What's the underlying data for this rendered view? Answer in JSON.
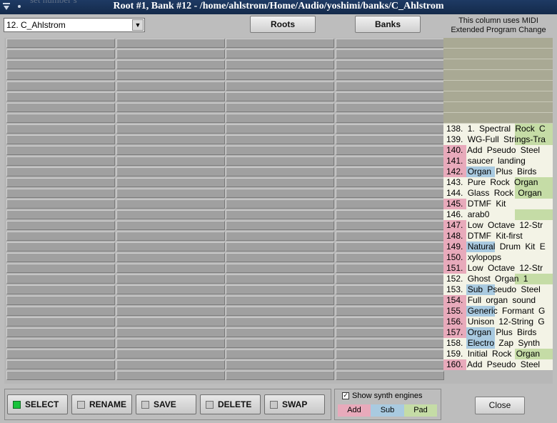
{
  "window": {
    "title": "Root #1, Bank #12 - /home/ahlstrom/Home/Audio/yoshimi/banks/C_Ahlstrom",
    "ghost_text": "set number s"
  },
  "toolbar": {
    "bank_selected": "12. C_Ahlstrom",
    "roots_label": "Roots",
    "banks_label": "Banks",
    "midi_note": "This column uses MIDI Extended Program Change"
  },
  "colors": {
    "add": "#e8aabb",
    "sub": "#a9cae0",
    "pad": "#c5dca6",
    "cell_text_bg": "#f3f3e6"
  },
  "bank_column": [
    {
      "label": "138. 1. Spectral  Rock  C",
      "add": false,
      "sub": false,
      "pad": true
    },
    {
      "label": "139. WG-Full  Strings-Tra",
      "add": false,
      "sub": false,
      "pad": true
    },
    {
      "label": "140. Add  Pseudo  Steel",
      "add": true,
      "sub": false,
      "pad": false
    },
    {
      "label": "141. saucer  landing",
      "add": true,
      "sub": false,
      "pad": false
    },
    {
      "label": "142. Organ  Plus  Birds",
      "add": true,
      "sub": true,
      "pad": false
    },
    {
      "label": "143. Pure  Rock  Organ",
      "add": false,
      "sub": false,
      "pad": true
    },
    {
      "label": "144. Glass  Rock  Organ",
      "add": false,
      "sub": false,
      "pad": true
    },
    {
      "label": "145. DTMF  Kit",
      "add": true,
      "sub": false,
      "pad": false
    },
    {
      "label": "146. arab0",
      "add": false,
      "sub": false,
      "pad": true
    },
    {
      "label": "147. Low  Octave  12-Str",
      "add": true,
      "sub": false,
      "pad": false
    },
    {
      "label": "148. DTMF  Kit-first",
      "add": true,
      "sub": false,
      "pad": false
    },
    {
      "label": "149. Natural  Drum  Kit  E",
      "add": true,
      "sub": true,
      "pad": false
    },
    {
      "label": "150. xylopops",
      "add": true,
      "sub": false,
      "pad": false
    },
    {
      "label": "151. Low  Octave  12-Str",
      "add": true,
      "sub": false,
      "pad": false
    },
    {
      "label": "152. Ghost  Organ  1",
      "add": false,
      "sub": false,
      "pad": true
    },
    {
      "label": "153. Sub  Pseudo  Steel",
      "add": false,
      "sub": true,
      "pad": false
    },
    {
      "label": "154. Full  organ  sound",
      "add": true,
      "sub": false,
      "pad": false
    },
    {
      "label": "155. Generic  Formant  G",
      "add": true,
      "sub": true,
      "pad": false
    },
    {
      "label": "156. Unison  12-String  G",
      "add": true,
      "sub": false,
      "pad": false
    },
    {
      "label": "157. Organ  Plus  Birds",
      "add": true,
      "sub": true,
      "pad": false
    },
    {
      "label": "158. Electro  Zap  Synth",
      "add": false,
      "sub": true,
      "pad": false
    },
    {
      "label": "159. Initial  Rock  Organ",
      "add": false,
      "sub": false,
      "pad": true
    },
    {
      "label": "160. Add  Pseudo  Steel",
      "add": true,
      "sub": false,
      "pad": false
    }
  ],
  "modes": [
    {
      "label": "SELECT",
      "active": true
    },
    {
      "label": "RENAME",
      "active": false
    },
    {
      "label": "SAVE",
      "active": false
    },
    {
      "label": "DELETE",
      "active": false
    },
    {
      "label": "SWAP",
      "active": false
    }
  ],
  "engines": {
    "show_label": "Show synth engines",
    "checked": true,
    "add_label": "Add",
    "sub_label": "Sub",
    "pad_label": "Pad"
  },
  "close_label": "Close"
}
